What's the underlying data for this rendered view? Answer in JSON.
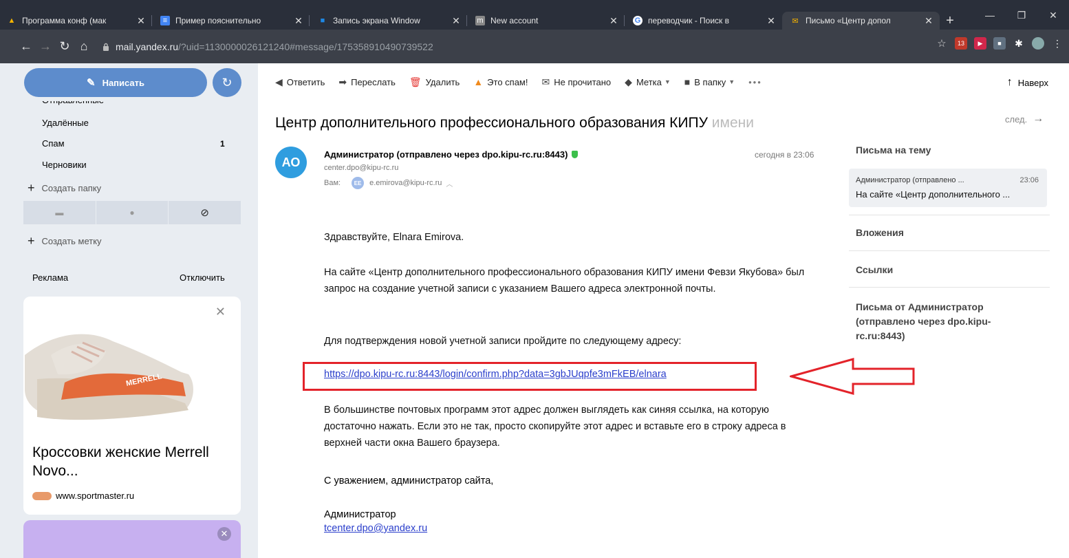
{
  "browser": {
    "tabs": [
      {
        "title": "Программа конф (мак",
        "icon": "drive-icon"
      },
      {
        "title": "Пример пояснительно",
        "icon": "docs-icon"
      },
      {
        "title": "Запись экрана Window",
        "icon": "windows-icon"
      },
      {
        "title": "New account",
        "icon": "moodle-icon"
      },
      {
        "title": "переводчик - Поиск в",
        "icon": "google-icon"
      },
      {
        "title": "Письмо «Центр допол",
        "icon": "yandex-mail-icon"
      }
    ],
    "url_host": "mail.yandex.ru",
    "url_path": "/?uid=1130000026121240#message/175358910490739522",
    "ext_badge": "13"
  },
  "sidebar": {
    "compose_label": "Написать",
    "folders": [
      {
        "name": "Отправленные",
        "count": ""
      },
      {
        "name": "Удалённые",
        "count": ""
      },
      {
        "name": "Спам",
        "count": "1"
      },
      {
        "name": "Черновики",
        "count": ""
      }
    ],
    "create_folder": "Создать папку",
    "create_label": "Создать метку",
    "ad_label": "Реклама",
    "ad_disable": "Отключить",
    "ad_title": "Кроссовки женские Merrell Novo...",
    "ad_site": "www.sportmaster.ru",
    "ad_brand": "MERRELL"
  },
  "toolbar": {
    "reply": "Ответить",
    "forward": "Переслать",
    "delete": "Удалить",
    "spam": "Это спам!",
    "unread": "Не прочитано",
    "label": "Метка",
    "folder": "В папку",
    "more": "•••",
    "top": "Наверх"
  },
  "message": {
    "title": "Центр дополнительного профессионального образования КИПУ",
    "title_fade": " имени",
    "next": "след.",
    "avatar": "АО",
    "sender": "Администратор (отправлено через dpo.kipu-rc.ru:8443)",
    "sender_email": "center.dpo@kipu-rc.ru",
    "to_label": "Вам:",
    "to_avatar": "EE",
    "to_email": "e.emirova@kipu-rc.ru",
    "date": "сегодня в 23:06",
    "greeting": "Здравствуйте, Elnara Emirova.",
    "para1": "На сайте «Центр дополнительного профессионального образования КИПУ имени Февзи Якубова» был запрос на создание учетной записи с указанием Вашего адреса электронной почты.",
    "para2": "Для подтверждения новой учетной записи пройдите по следующему адресу:",
    "link": "https://dpo.kipu-rc.ru:8443/login/confirm.php?data=3gbJUqpfe3mFkEB/elnara",
    "para3": "В большинстве почтовых программ этот адрес должен выглядеть как синяя ссылка, на которую достаточно нажать. Если это не так, просто скопируйте этот адрес и вставьте его в строку адреса в верхней части окна Вашего браузера.",
    "regards": "С уважением, администратор сайта,",
    "sig_name": "Администратор",
    "sig_email": "tcenter.dpo@yandex.ru"
  },
  "right_panel": {
    "thread_heading": "Письма на тему",
    "thread_from": "Администратор (отправлено ...",
    "thread_time": "23:06",
    "thread_subject": "На сайте «Центр дополнительного ...",
    "attachments": "Вложения",
    "links": "Ссылки",
    "from_heading": "Письма от Администратор (отправлено через dpo.kipu-rc.ru:8443)"
  },
  "colors": {
    "compose": "#5d8ccc",
    "link": "#2a3ecb",
    "highlight": "#e3232a",
    "avatar": "#2f9ddf"
  }
}
